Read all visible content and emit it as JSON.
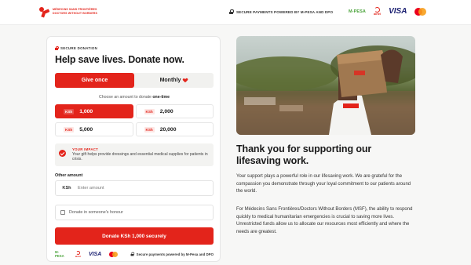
{
  "header": {
    "logo_lines": [
      "MÉDECINS SANS FRONTIÈRES",
      "DOCTORS WITHOUT BORDERS"
    ],
    "secure_text": "SECURE PAYMENTS POWERED BY M-PESA AND DPO",
    "logos": {
      "mpesa": "M-PESA",
      "airtel": "airtel",
      "visa": "VISA"
    }
  },
  "form": {
    "eyebrow": "SECURE DONATION",
    "title": "Help save lives. Donate now.",
    "frequency": {
      "once": "Give once",
      "monthly": "Monthly",
      "selected": "once"
    },
    "choose_prefix": "Choose an amount to donate",
    "choose_bold": "one-time",
    "currency": "KSh",
    "amounts": [
      {
        "value": "1,000",
        "selected": true
      },
      {
        "value": "2,000",
        "selected": false
      },
      {
        "value": "5,000",
        "selected": false
      },
      {
        "value": "20,000",
        "selected": false
      }
    ],
    "impact": {
      "label": "YOUR IMPACT",
      "text": "Your gift helps provide dressings and essential medical supplies for patients in crisis."
    },
    "other_amount_label": "Other amount",
    "other_amount_currency": "KSh",
    "other_amount_placeholder": "Enter amount",
    "honour_label": "Donate in someone's honour",
    "honour_checked": false,
    "donate_button": "Donate KSh 1,000 securely",
    "footer_secure": "Secure payments powered by M-Pesa and DPO",
    "footer_logos": {
      "mpesa": "M-PESA",
      "airtel": "airtel",
      "visa": "VISA"
    }
  },
  "content": {
    "title": "Thank you for supporting our lifesaving work.",
    "paragraph1": "Your support plays a powerful role in our lifesaving work. We are grateful for the compassion you demonstrate through your loyal commitment to our patients around the world.",
    "paragraph2": "For Médecins Sans Frontières/Doctors Without Borders (MSF), the ability to respond quickly to medical humanitarian emergencies is crucial to saving more lives. Unrestricted funds allow us to allocate our resources most efficiently and where the needs are greatest."
  },
  "colors": {
    "brand_red": "#e3241b",
    "mpesa_green": "#4aa33a",
    "visa_blue": "#1a1f71"
  },
  "icons": [
    "msf-logo-icon",
    "lock-icon",
    "heart-icon",
    "check-icon",
    "checkbox-icon",
    "mpesa-logo",
    "airtel-logo",
    "visa-logo",
    "mastercard-logo"
  ]
}
